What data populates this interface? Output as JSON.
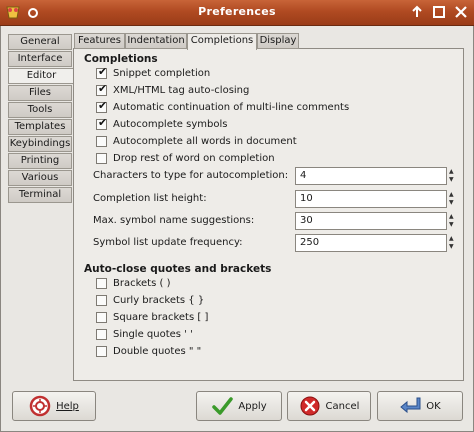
{
  "window": {
    "title": "Preferences"
  },
  "sidebar": {
    "items": [
      {
        "label": "General",
        "active": false
      },
      {
        "label": "Interface",
        "active": false
      },
      {
        "label": "Editor",
        "active": true
      },
      {
        "label": "Files",
        "active": false
      },
      {
        "label": "Tools",
        "active": false
      },
      {
        "label": "Templates",
        "active": false
      },
      {
        "label": "Keybindings",
        "active": false
      },
      {
        "label": "Printing",
        "active": false
      },
      {
        "label": "Various",
        "active": false
      },
      {
        "label": "Terminal",
        "active": false
      }
    ]
  },
  "tabs": [
    {
      "label": "Features",
      "active": false
    },
    {
      "label": "Indentation",
      "active": false
    },
    {
      "label": "Completions",
      "active": true
    },
    {
      "label": "Display",
      "active": false
    }
  ],
  "completions": {
    "title": "Completions",
    "checkboxes": [
      {
        "label": "Snippet completion",
        "checked": true
      },
      {
        "label": "XML/HTML tag auto-closing",
        "checked": true
      },
      {
        "label": "Automatic continuation of multi-line comments",
        "checked": true
      },
      {
        "label": "Autocomplete symbols",
        "checked": true
      },
      {
        "label": "Autocomplete all words in document",
        "checked": false
      },
      {
        "label": "Drop rest of word on completion",
        "checked": false
      }
    ],
    "spins": [
      {
        "label": "Characters to type for autocompletion:",
        "value": "4"
      },
      {
        "label": "Completion list height:",
        "value": "10"
      },
      {
        "label": "Max. symbol name suggestions:",
        "value": "30"
      },
      {
        "label": "Symbol list update frequency:",
        "value": "250"
      }
    ]
  },
  "autoclose": {
    "title": "Auto-close quotes and brackets",
    "checkboxes": [
      {
        "label": "Brackets ( )",
        "checked": false
      },
      {
        "label": "Curly brackets { }",
        "checked": false
      },
      {
        "label": "Square brackets [ ]",
        "checked": false
      },
      {
        "label": "Single quotes ' '",
        "checked": false
      },
      {
        "label": "Double quotes \" \"",
        "checked": false
      }
    ]
  },
  "buttons": {
    "help": "Help",
    "apply": "Apply",
    "cancel": "Cancel",
    "ok": "OK"
  },
  "colors": {
    "titlebar": "#b04a22",
    "window_bg": "#e9e7e3"
  }
}
